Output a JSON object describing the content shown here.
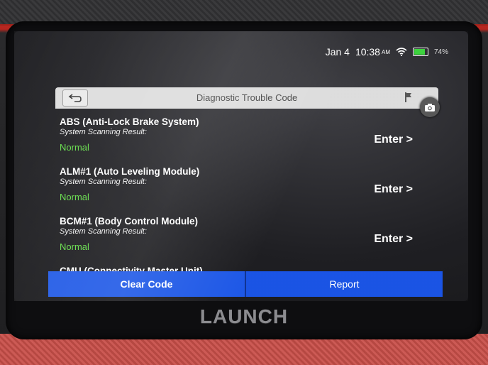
{
  "status_bar": {
    "date": "Jan 4",
    "time": "10:38",
    "ampm": "AM",
    "battery_percent": "74%",
    "battery_level": 0.74
  },
  "header": {
    "title": "Diagnostic Trouble Code"
  },
  "systems": [
    {
      "name": "ABS (Anti-Lock Brake System)",
      "result_label": "System Scanning Result:",
      "result": "Normal",
      "action": "Enter >"
    },
    {
      "name": "ALM#1 (Auto Leveling Module)",
      "result_label": "System Scanning Result:",
      "result": "Normal",
      "action": "Enter >"
    },
    {
      "name": "BCM#1 (Body Control Module)",
      "result_label": "System Scanning Result:",
      "result": "Normal",
      "action": "Enter >"
    },
    {
      "name": "CMU (Connectivity Master Unit)"
    }
  ],
  "buttons": {
    "clear_code": "Clear Code",
    "report": "Report"
  },
  "brand": "LAUNCH",
  "colors": {
    "status_normal": "#5fdc43",
    "action_button": "#1a55e6",
    "housing_red": "#c9302a"
  }
}
